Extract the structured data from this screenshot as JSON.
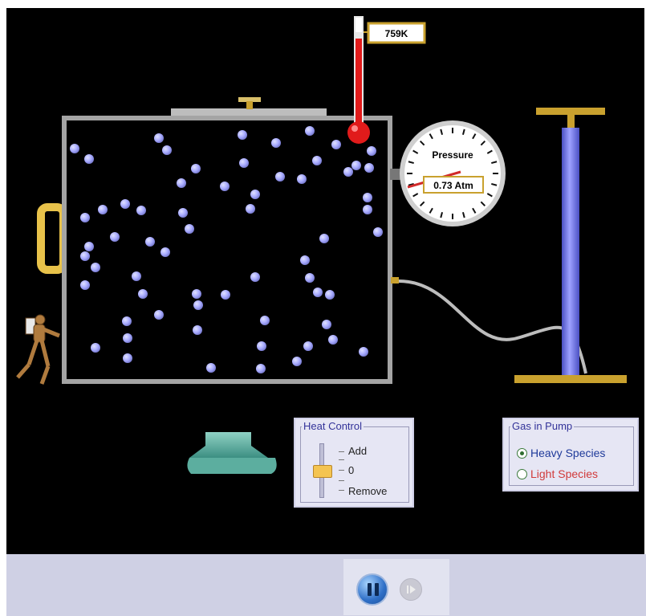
{
  "thermometer": {
    "reading": "759K"
  },
  "pressure_gauge": {
    "title": "Pressure",
    "reading": "0.73 Atm"
  },
  "heat_control": {
    "title": "Heat Control",
    "add_label": "Add",
    "zero_label": "0",
    "remove_label": "Remove",
    "level": 0
  },
  "gas_in_pump": {
    "title": "Gas in Pump",
    "options": [
      {
        "label": "Heavy Species",
        "selected": true,
        "color": "#1f3a9a"
      },
      {
        "label": "Light Species",
        "selected": false,
        "color": "#d13a3a"
      }
    ]
  },
  "playback": {
    "state": "playing"
  },
  "colors": {
    "particle": "#a9acff",
    "thermometer": "#e11b1b",
    "pump_barrel": "#6f74e6",
    "pump_brass": "#c9a12e",
    "box_wall": "#9a9a9a"
  }
}
